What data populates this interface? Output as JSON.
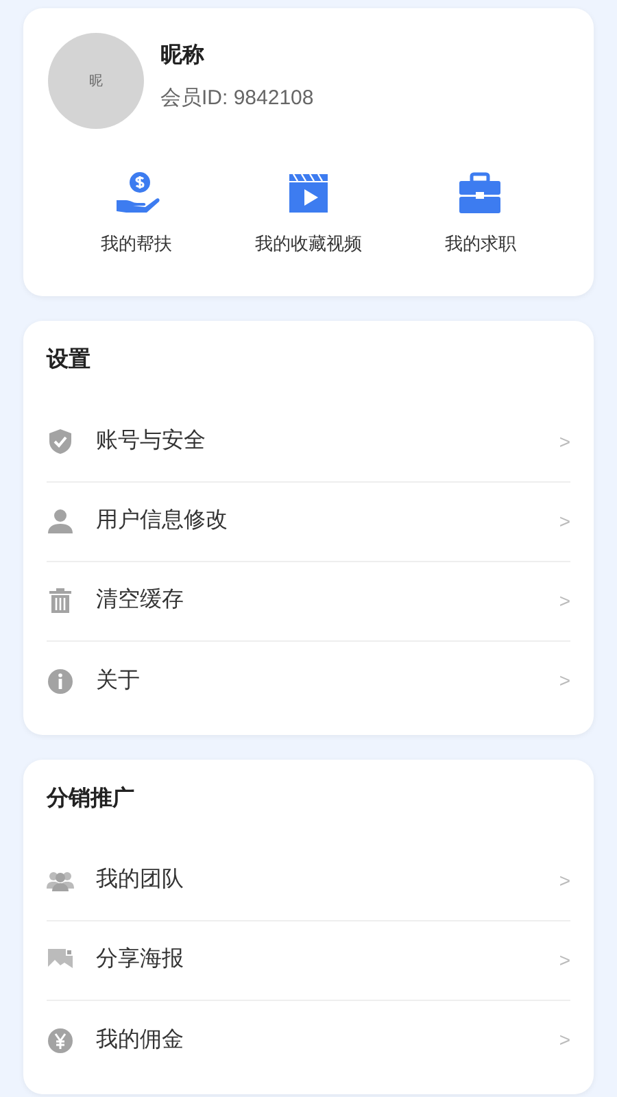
{
  "profile": {
    "avatar_text": "昵",
    "nickname": "昵称",
    "member_id": "会员ID: 9842108"
  },
  "shortcuts": [
    {
      "kind": "help",
      "label": "我的帮扶"
    },
    {
      "kind": "video",
      "label": "我的收藏视频"
    },
    {
      "kind": "job",
      "label": "我的求职"
    }
  ],
  "sections": [
    {
      "title": "设置",
      "items": [
        {
          "kind": "shield",
          "label": "账号与安全",
          "arrow": ">"
        },
        {
          "kind": "user",
          "label": "用户信息修改",
          "arrow": ">"
        },
        {
          "kind": "trash",
          "label": "清空缓存",
          "arrow": ">"
        },
        {
          "kind": "info",
          "label": "关于",
          "arrow": ">"
        }
      ]
    },
    {
      "title": "分销推广",
      "items": [
        {
          "kind": "team",
          "label": "我的团队",
          "arrow": ">"
        },
        {
          "kind": "poster",
          "label": "分享海报",
          "arrow": ">"
        },
        {
          "kind": "yen",
          "label": "我的佣金",
          "arrow": ">"
        }
      ]
    }
  ]
}
